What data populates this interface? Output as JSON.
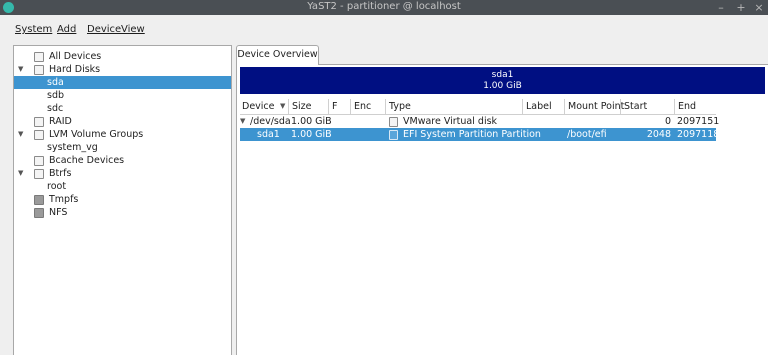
{
  "window": {
    "title": "YaST2 - partitioner @ localhost",
    "controls": {
      "minimize": "–",
      "maximize": "+",
      "close": "×"
    }
  },
  "menubar": {
    "items": [
      "System",
      "Add",
      "Device",
      "View"
    ]
  },
  "tree": {
    "items": [
      {
        "label": "All Devices",
        "icon": "monitor-icon"
      },
      {
        "label": "Hard Disks",
        "icon": "harddisk-icon",
        "expanded": true
      },
      {
        "label": "sda",
        "selected": true
      },
      {
        "label": "sdb"
      },
      {
        "label": "sdc"
      },
      {
        "label": "RAID",
        "icon": "raid-icon"
      },
      {
        "label": "LVM Volume Groups",
        "icon": "lvm-icon",
        "expanded": true
      },
      {
        "label": "system_vg"
      },
      {
        "label": "Bcache Devices",
        "icon": "bcache-icon"
      },
      {
        "label": "Btrfs",
        "icon": "btrfs-icon",
        "expanded": true
      },
      {
        "label": "root"
      },
      {
        "label": "Tmpfs",
        "icon": "tmpfs-icon"
      },
      {
        "label": "NFS",
        "icon": "nfs-icon"
      }
    ]
  },
  "tab": {
    "label": "Device Overview"
  },
  "diskbar": {
    "name": "sda1",
    "size": "1.00 GiB"
  },
  "table": {
    "columns": [
      "Device",
      "Size",
      "F",
      "Enc",
      "Type",
      "Label",
      "Mount Point",
      "Start",
      "End"
    ],
    "rows": [
      {
        "device": "/dev/sda",
        "size": "1.00 GiB",
        "f": "",
        "enc": "",
        "type": "VMware Virtual disk",
        "label": "",
        "mount": "",
        "start": "0",
        "end": "2097151",
        "expanded": true
      },
      {
        "device": "sda1",
        "size": "1.00 GiB",
        "f": "",
        "enc": "",
        "type": "EFI System Partition Partition",
        "label": "",
        "mount": "/boot/efi",
        "start": "2048",
        "end": "2097118",
        "selected": true
      }
    ]
  },
  "colors": {
    "titlebar": "#4a4f54",
    "accent_selection": "#3d94d0",
    "diskbar": "#000f82",
    "app_icon": "#35b9ab"
  }
}
